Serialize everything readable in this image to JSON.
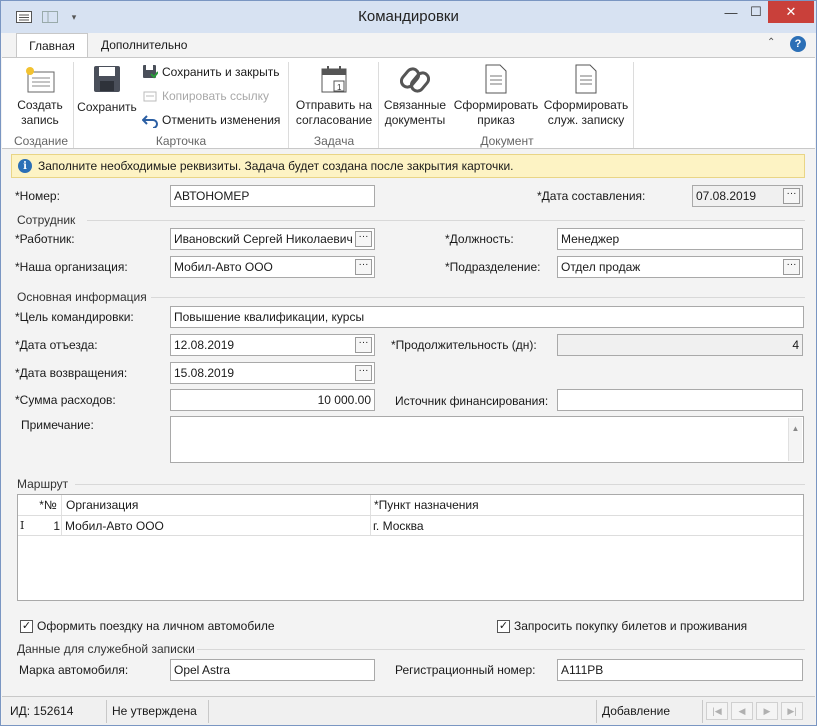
{
  "window": {
    "title": "Командировки"
  },
  "ribbon": {
    "tabs": [
      "Главная",
      "Дополнительно"
    ],
    "create": {
      "label1": "Создать",
      "label2": "запись",
      "group": "Создание"
    },
    "save": "Сохранить",
    "save_close": "Сохранить и закрыть",
    "copy_link": "Копировать ссылку",
    "cancel_changes": "Отменить изменения",
    "card_group": "Карточка",
    "send": {
      "label1": "Отправить на",
      "label2": "согласование",
      "group": "Задача"
    },
    "linked": {
      "label1": "Связанные",
      "label2": "документы"
    },
    "make_order": {
      "label1": "Сформировать",
      "label2": "приказ"
    },
    "make_memo": {
      "label1": "Сформировать",
      "label2": "служ. записку"
    },
    "doc_group": "Документ"
  },
  "info": "Заполните необходимые реквизиты. Задача будет создана после закрытия карточки.",
  "form": {
    "number_label": "*Номер:",
    "number": "АВТОНОМЕР",
    "date_label": "*Дата составления:",
    "date": "07.08.2019",
    "employee_section": "Сотрудник",
    "worker_label": "*Работник:",
    "worker": "Ивановский Сергей Николаевич",
    "position_label": "*Должность:",
    "position": "Менеджер",
    "org_label": "*Наша организация:",
    "org": "Мобил-Авто ООО",
    "dept_label": "*Подразделение:",
    "dept": "Отдел продаж",
    "main_section": "Основная информация",
    "purpose_label": "*Цель командировки:",
    "purpose": "Повышение квалификации, курсы",
    "depart_label": "*Дата отъезда:",
    "depart": "12.08.2019",
    "duration_label": "*Продолжительность (дн):",
    "duration": "4",
    "return_label": "*Дата возвращения:",
    "return": "15.08.2019",
    "expenses_label": "*Сумма расходов:",
    "expenses": "10 000.00",
    "funding_label": "Источник финансирования:",
    "funding": "",
    "note_label": "Примечание:",
    "note": ""
  },
  "route": {
    "section": "Маршрут",
    "headers": {
      "num": "*№",
      "org": "Организация",
      "dest": "*Пункт назначения"
    },
    "rows": [
      {
        "num": "1",
        "org": "Мобил-Авто ООО",
        "dest": "г. Москва"
      }
    ]
  },
  "options": {
    "personal_car": "Оформить поездку на личном автомобиле",
    "tickets": "Запросить покупку билетов и проживания"
  },
  "memo": {
    "section": "Данные для служебной записки",
    "car_label": "Марка автомобиля:",
    "car": "Opel Astra",
    "reg_label": "Регистрационный номер:",
    "reg": "А111РВ"
  },
  "status": {
    "id": "ИД: 152614",
    "state": "Не утверждена",
    "mode": "Добавление"
  }
}
